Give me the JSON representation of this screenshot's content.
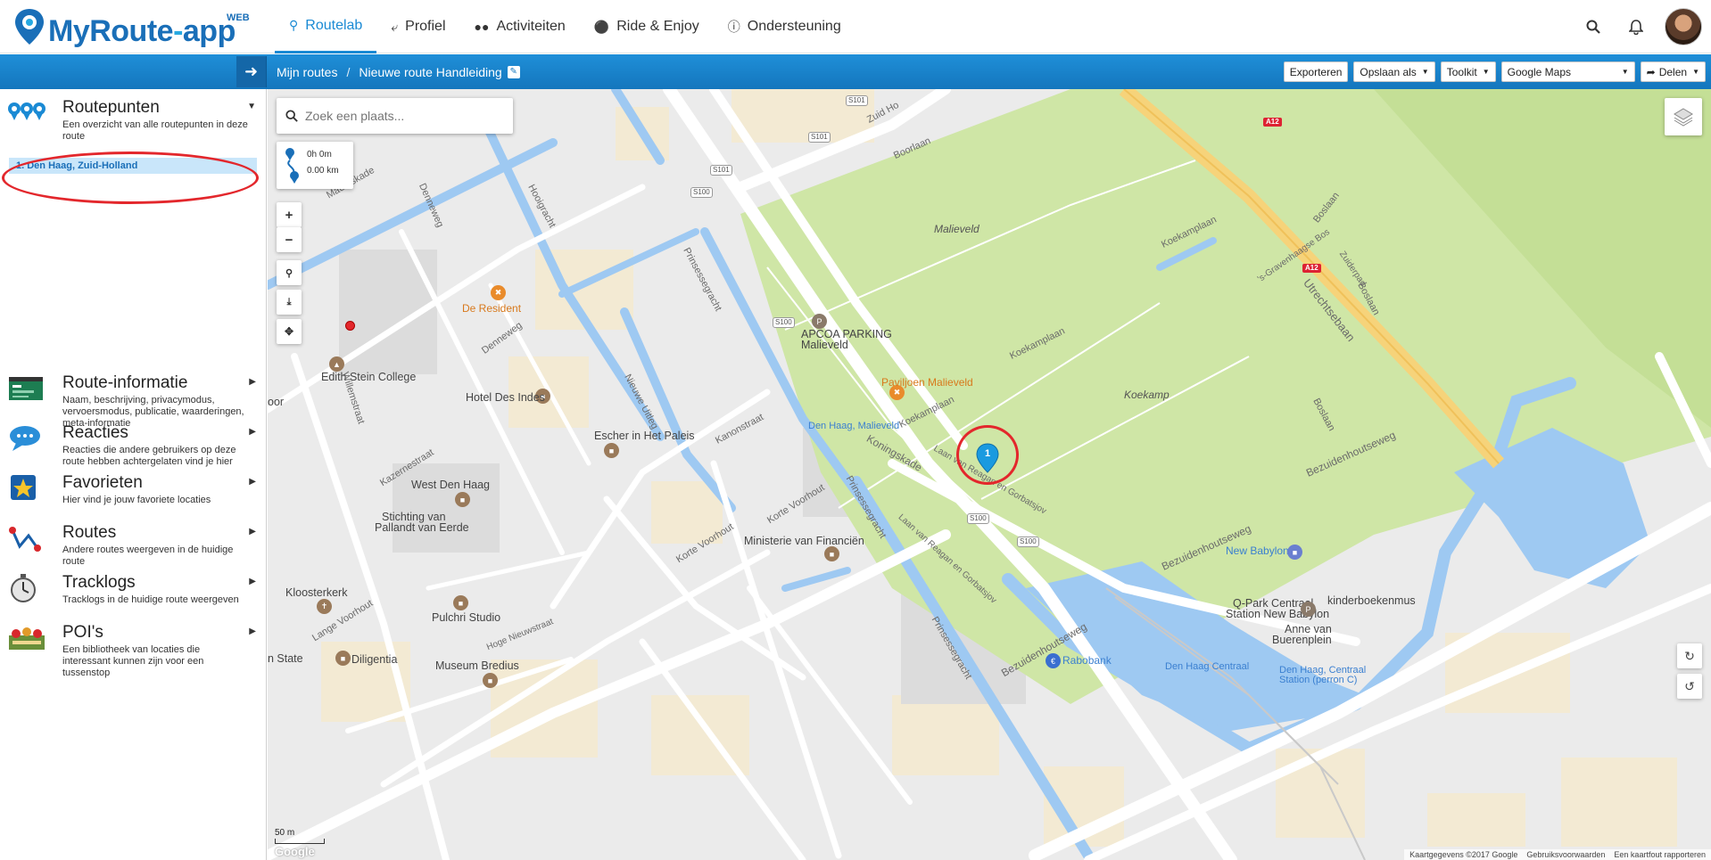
{
  "app": {
    "brand_main": "MyRoute",
    "brand_dash": "-",
    "brand_suffix": "app",
    "web_badge": "WEB"
  },
  "nav": {
    "tabs": [
      {
        "label": "Routelab",
        "icon": "map-marker-icon",
        "active": true
      },
      {
        "label": "Profiel",
        "icon": "share-icon"
      },
      {
        "label": "Activiteiten",
        "icon": "users-icon"
      },
      {
        "label": "Ride & Enjoy",
        "icon": "trophy-icon"
      },
      {
        "label": "Ondersteuning",
        "icon": "info-icon"
      }
    ]
  },
  "toolbar": {
    "breadcrumb_root": "Mijn routes",
    "breadcrumb_sep": "/",
    "route_name": "Nieuwe route Handleiding",
    "export_label": "Exporteren",
    "save_as_label": "Opslaan als",
    "toolkit_label": "Toolkit",
    "map_provider": "Google Maps",
    "share_label": "Delen"
  },
  "sidebar": {
    "routepoints": {
      "title": "Routepunten",
      "desc": "Een overzicht van alle routepunten in deze route"
    },
    "routepoint_items": [
      {
        "label": "1. Den Haag, Zuid-Holland"
      }
    ],
    "sections": [
      {
        "title": "Route-informatie",
        "desc": "Naam, beschrijving, privacymodus, vervoersmodus, publicatie, waarderingen, meta-informatie"
      },
      {
        "title": "Reacties",
        "desc": "Reacties die andere gebruikers op deze route hebben achtergelaten vind je hier"
      },
      {
        "title": "Favorieten",
        "desc": "Hier vind je jouw favoriete locaties"
      },
      {
        "title": "Routes",
        "desc": "Andere routes weergeven in de huidige route"
      },
      {
        "title": "Tracklogs",
        "desc": "Tracklogs in de huidige route weergeven"
      },
      {
        "title": "POI's",
        "desc": "Een bibliotheek van locaties die interessant kunnen zijn voor een tussenstop"
      }
    ]
  },
  "map": {
    "search_placeholder": "Zoek een plaats...",
    "duration": "0h 0m",
    "distance": "0.00 km",
    "marker_number": "1",
    "scale": "50 m",
    "google": "Google",
    "footer": {
      "data": "Kaartgegevens ©2017 Google",
      "terms": "Gebruiksvoorwaarden",
      "report": "Een kaartfout rapporteren"
    },
    "labels": {
      "malieveld": "Malieveld",
      "koekamp": "Koekamp",
      "apcoa1": "APCOA PARKING",
      "apcoa2": "Malieveld",
      "paviljoen": "Paviljoen Malieveld",
      "station_malieveld": "Den Haag, Malieveld",
      "de_resident": "De Resident",
      "edith": "Edith Stein College",
      "hotel": "Hotel Des Indes",
      "escher": "Escher in Het Paleis",
      "west": "West Den Haag",
      "stichting1": "Stichting van",
      "stichting2": "Pallandt van Eerde",
      "ministerie": "Ministerie van Financiën",
      "kloosterkerk": "Kloosterkerk",
      "pulchri": "Pulchri Studio",
      "diligentia": "Diligentia",
      "bredius": "Museum Bredius",
      "new_babylon": "New Babylon",
      "qpark1": "Q-Park Centraal",
      "qpark2": "Station New Babylon",
      "kinderboeken": "kinderboekenmus",
      "anne1": "Anne van",
      "anne2": "Buerenplein",
      "rabobank": "Rabobank",
      "dh_centraal1": "Den Haag Centraal",
      "dh_centraal2": "Den Haag, Centraal",
      "dh_centraal3": "Station (perron C)",
      "state": "n State",
      "oor": "oor",
      "boorlaan": "Boorlaan",
      "koekamplaan": "Koekamplaan",
      "utrechtsebaan": "Utrechtsebaan",
      "boslaan": "Boslaan",
      "bezuidenhoutseweg": "Bezuidenhoutseweg",
      "koningskade": "Koningskade",
      "laan_reagan": "Laan van Reagan en Gorbatsjov",
      "prinsessegracht": "Prinsessegracht",
      "mauritskade": "Mauritskade",
      "hooigracht": "Hooigracht",
      "hoge_nieuwstraat": "Hoge Nieuwstraat",
      "lange_voorhout": "Lange Voorhout",
      "korte_voorhout": "Korte Voorhout",
      "nieuwe_uitleg": "Nieuwe Uitleg",
      "kanonstraat": "Kanonstraat",
      "willemstraat": "Willemstraat",
      "denneweg": "Denneweg",
      "kazernestraat": "Kazernestraat",
      "zuid_hollandlaan": "Zuid Ho",
      "bos": "'s-Gravenhaagse Bos",
      "zuiderpad": "Zuiderpad",
      "a12": "A12",
      "s100": "S100",
      "s101": "S101"
    }
  },
  "colors": {
    "accent": "#1a8ad4",
    "toolbar": "#1476bd",
    "highlight": "#e3272c",
    "park": "#cfe6a6",
    "water": "#9ec9f2"
  }
}
